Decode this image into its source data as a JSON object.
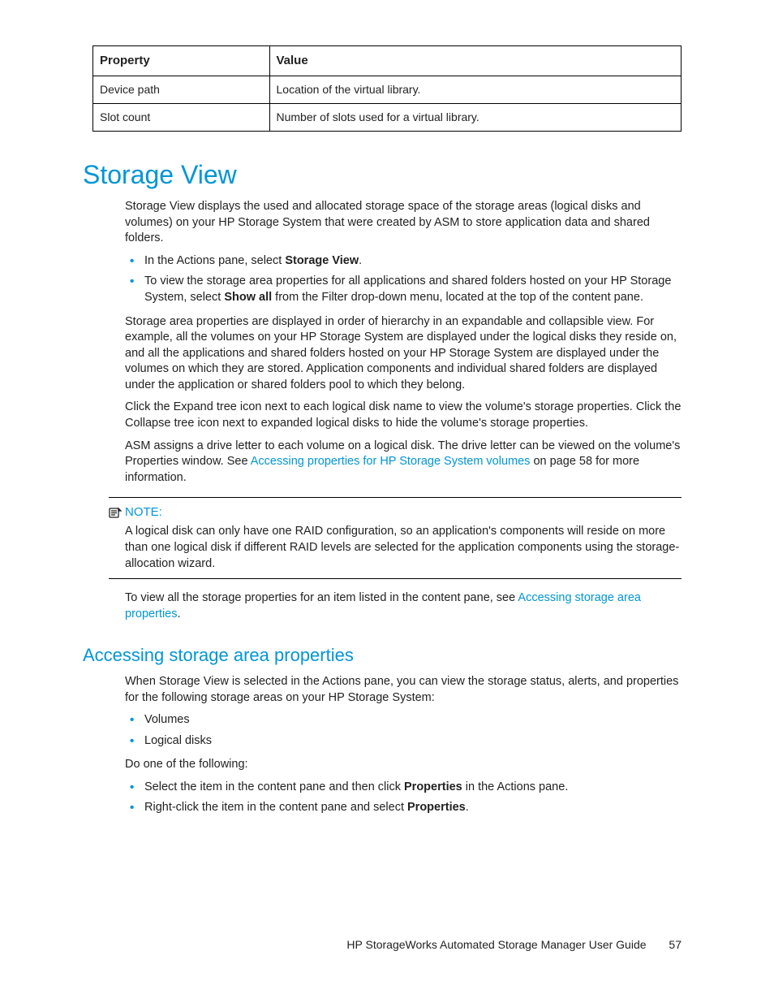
{
  "table": {
    "headers": [
      "Property",
      "Value"
    ],
    "rows": [
      [
        "Device path",
        "Location of the virtual library."
      ],
      [
        "Slot count",
        "Number of slots used for a virtual library."
      ]
    ]
  },
  "heading1": "Storage View",
  "para1": "Storage View displays the used and allocated storage space of the storage areas (logical disks and volumes) on your HP Storage System that were created by ASM to store application data and shared folders.",
  "bullets1": {
    "i1a": "In the Actions pane, select ",
    "i1b_bold": "Storage View",
    "i1c": ".",
    "i2a": "To view the storage area properties for all applications and shared folders hosted on your HP Storage System, select ",
    "i2b_bold": "Show all",
    "i2c": " from the Filter drop-down menu, located at the top of the content pane."
  },
  "para2": "Storage area properties are displayed in order of hierarchy in an expandable and collapsible view. For example, all the volumes on your HP Storage System are displayed under the logical disks they reside on, and all the applications and shared folders hosted on your HP Storage System are displayed under the volumes on which they are stored. Application components and individual shared folders are displayed under the application or shared folders pool to which they belong.",
  "para3": "Click the Expand tree icon next to each logical disk name to view the volume's storage properties. Click the Collapse tree icon next to expanded logical disks to hide the volume's storage properties.",
  "para4a": "ASM assigns a drive letter to each volume on a logical disk. The drive letter can be viewed on the volume's Properties window. See ",
  "para4_link": "Accessing properties for HP Storage System volumes",
  "para4b": " on page 58 for more information.",
  "note_label": "NOTE:",
  "note_text": "A logical disk can only have one RAID configuration, so an application's components will reside on more than one logical disk if different RAID levels are selected for the application components using the storage-allocation wizard.",
  "para5a": "To view all the storage properties for an item listed in the content pane, see ",
  "para5_link": "Accessing storage area properties",
  "para5b": ".",
  "heading2": "Accessing storage area properties",
  "para6": "When Storage View is selected in the Actions pane, you can view the storage status, alerts, and properties for the following storage areas on your HP Storage System:",
  "bullets2": {
    "i1": "Volumes",
    "i2": "Logical disks"
  },
  "para7": "Do one of the following:",
  "bullets3": {
    "i1a": "Select the item in the content pane and then click ",
    "i1b_bold": "Properties",
    "i1c": " in the Actions pane.",
    "i2a": "Right-click the item in the content pane and select ",
    "i2b_bold": "Properties",
    "i2c": "."
  },
  "footer_text": "HP StorageWorks Automated Storage Manager User Guide",
  "footer_page": "57"
}
